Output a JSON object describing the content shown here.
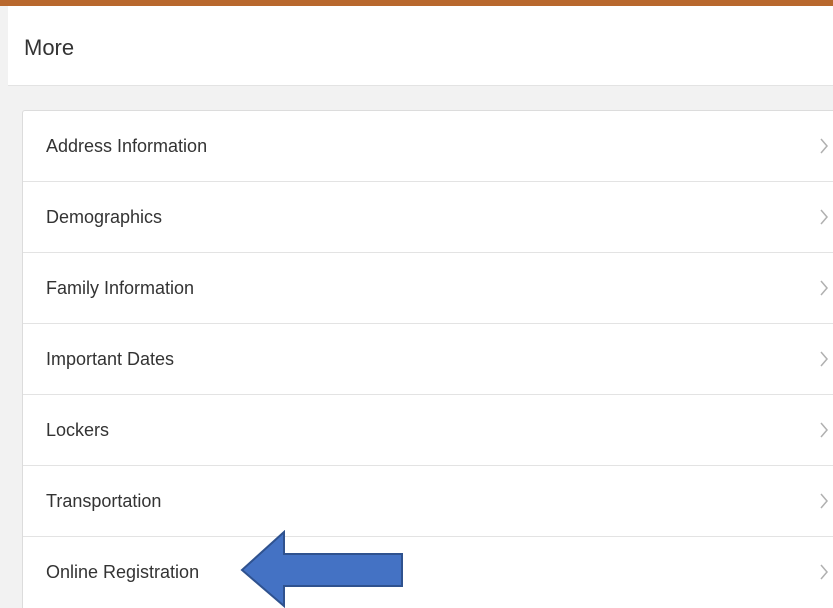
{
  "header": {
    "title": "More"
  },
  "list": {
    "items": [
      {
        "label": "Address Information"
      },
      {
        "label": "Demographics"
      },
      {
        "label": "Family Information"
      },
      {
        "label": "Important Dates"
      },
      {
        "label": "Lockers"
      },
      {
        "label": "Transportation"
      },
      {
        "label": "Online Registration"
      }
    ]
  },
  "icons": {
    "chevron": "chevron-right-icon",
    "arrow": "arrow-left-icon"
  },
  "colors": {
    "accent_bar": "#b8682e",
    "arrow_fill": "#4472c4",
    "arrow_stroke": "#2f528f",
    "chevron": "#b0b0b0"
  }
}
